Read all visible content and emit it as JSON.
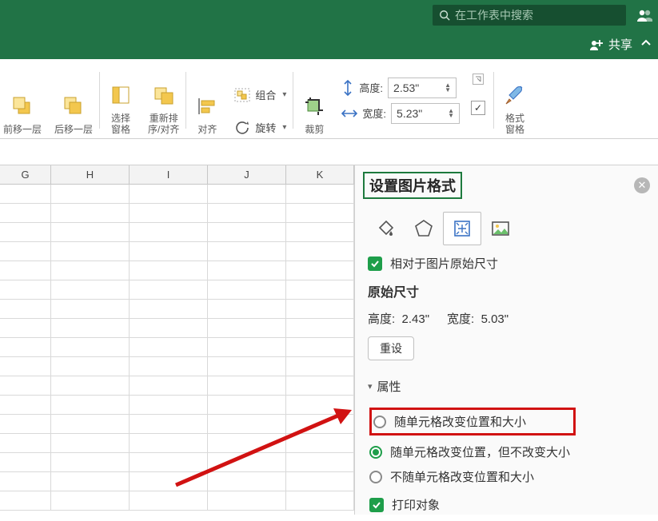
{
  "search": {
    "placeholder": "在工作表中搜索"
  },
  "share": {
    "label": "共享"
  },
  "ribbon": {
    "forward": "前移一层",
    "backward": "后移一层",
    "selection_pane": "选择\n窗格",
    "reorder": "重新排\n序/对齐",
    "align": "对齐",
    "rotate": "旋转",
    "group": "组合",
    "crop": "裁剪",
    "height_label": "高度:",
    "width_label": "宽度:",
    "height_value": "2.53\"",
    "width_value": "5.23\"",
    "format_pane": "格式\n窗格"
  },
  "columns": [
    "G",
    "H",
    "I",
    "J",
    "K"
  ],
  "panel": {
    "title": "设置图片格式",
    "relative_to_original": "相对于图片原始尺寸",
    "original_size_title": "原始尺寸",
    "orig_height_label": "高度:",
    "orig_height_value": "2.43\"",
    "orig_width_label": "宽度:",
    "orig_width_value": "5.03\"",
    "reset": "重设",
    "properties_section": "属性",
    "opt_move_size": "随单元格改变位置和大小",
    "opt_move_no_size": "随单元格改变位置，但不改变大小",
    "opt_no_move": "不随单元格改变位置和大小",
    "print_object": "打印对象"
  }
}
